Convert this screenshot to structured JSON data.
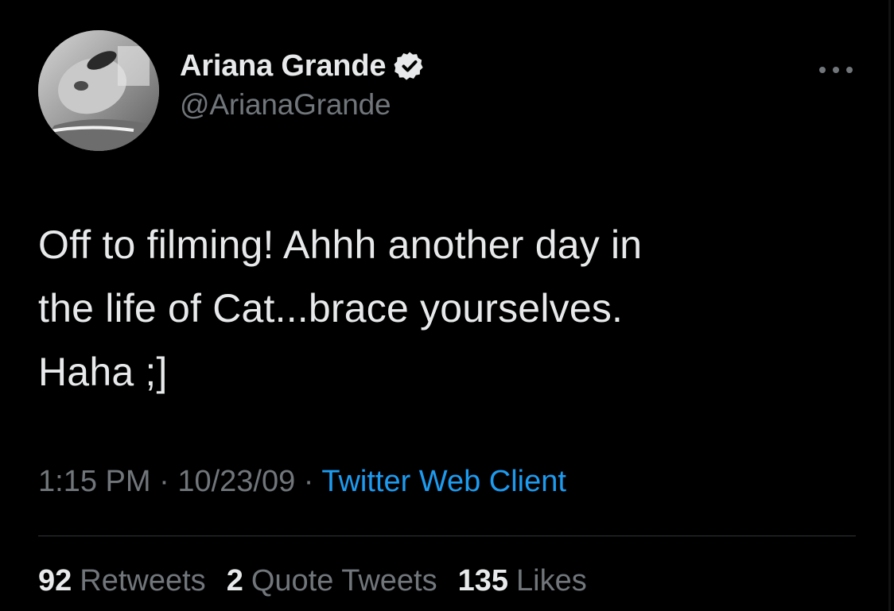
{
  "user": {
    "display_name": "Ariana Grande",
    "handle": "@ArianaGrande",
    "verified": true
  },
  "tweet": {
    "lines": [
      "Off to filming! Ahhh another day in",
      "the life of Cat...brace yourselves.",
      "Haha ;]"
    ],
    "time": "1:15 PM",
    "separator": "·",
    "date": "10/23/09",
    "source": "Twitter Web Client"
  },
  "stats": {
    "retweets_count": "92",
    "retweets_label": "Retweets",
    "quotes_count": "2",
    "quotes_label": "Quote Tweets",
    "likes_count": "135",
    "likes_label": "Likes"
  },
  "colors": {
    "background": "#000000",
    "text": "#e7e9ea",
    "secondary": "#71767b",
    "link": "#1d9bf0",
    "divider": "#2f3336"
  }
}
